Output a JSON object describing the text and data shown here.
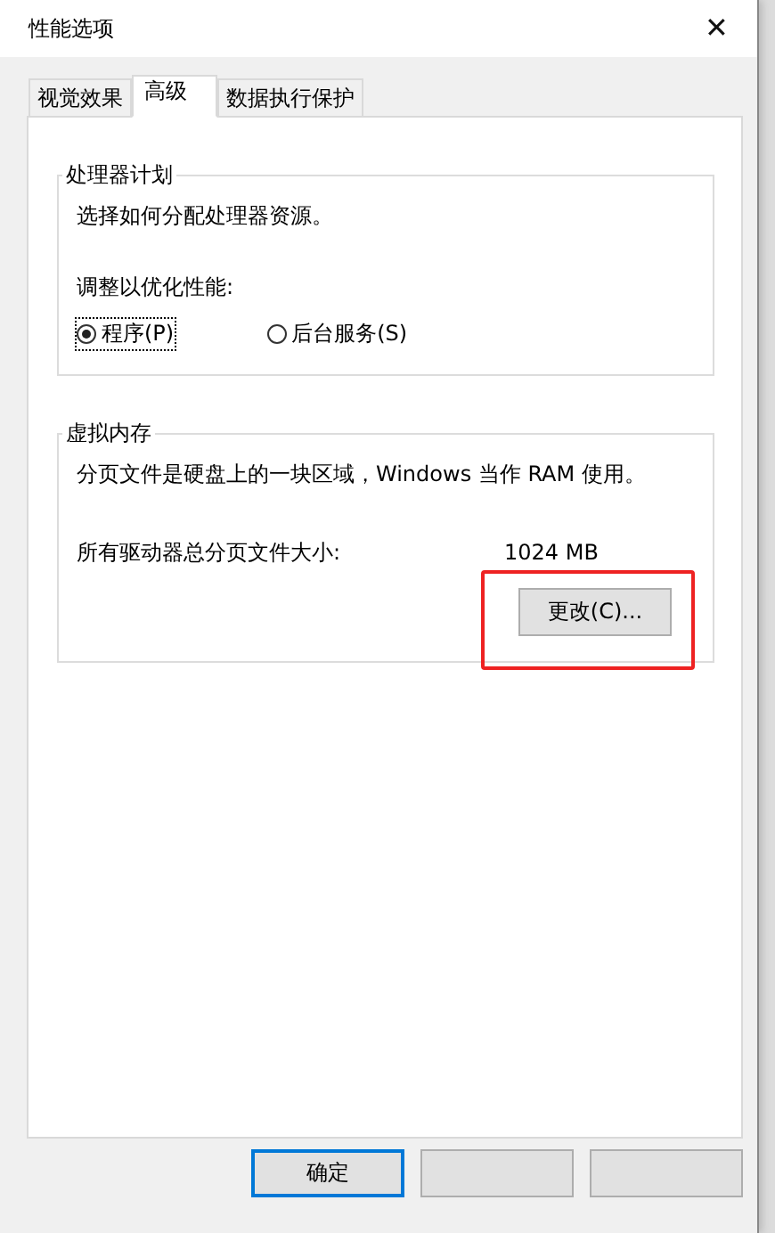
{
  "window": {
    "title": "性能选项",
    "close": "✕"
  },
  "tabs": [
    {
      "label": "视觉效果",
      "selected": false
    },
    {
      "label": "高级",
      "selected": true
    },
    {
      "label": "数据执行保护",
      "selected": false
    }
  ],
  "processor_group": {
    "title": "处理器计划",
    "description": "选择如何分配处理器资源。",
    "prompt": "调整以优化性能:",
    "options": [
      {
        "label": "程序(P)",
        "selected": true,
        "focused": true
      },
      {
        "label": "后台服务(S)",
        "selected": false,
        "focused": false
      }
    ]
  },
  "memory_group": {
    "title": "虚拟内存",
    "description": "分页文件是硬盘上的一块区域，Windows 当作 RAM 使用。",
    "size_label": "所有驱动器总分页文件大小:",
    "size_value": "1024 MB",
    "change_button": "更改(C)...",
    "highlighted": true
  },
  "buttons": [
    {
      "label": "确定",
      "default": true
    },
    {
      "default": false
    },
    {
      "default": false
    }
  ]
}
